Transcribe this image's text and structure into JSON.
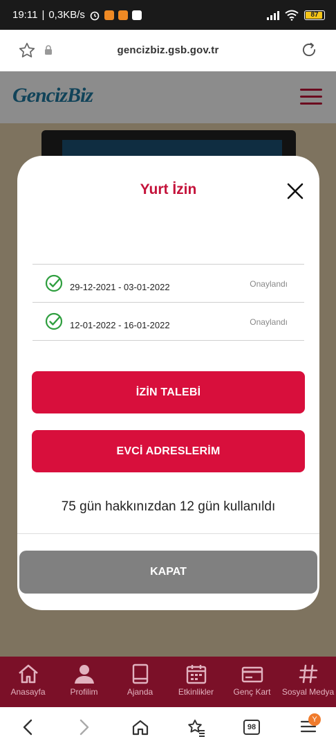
{
  "status_bar": {
    "time": "19:11",
    "speed": "0,3KB/s",
    "battery": "87"
  },
  "browser": {
    "url": "gencizbiz.gsb.gov.tr",
    "tab_count": "98",
    "menu_badge": "Y"
  },
  "site": {
    "logo": "GencizBiz",
    "brand_color": "#c4123a"
  },
  "modal": {
    "title": "Yurt İzin",
    "permits": [
      {
        "dates": "29-12-2021 - 03-01-2022",
        "status": "Onaylandı"
      },
      {
        "dates": "12-01-2022 - 16-01-2022",
        "status": "Onaylandı"
      }
    ],
    "request_button": "İZİN TALEBİ",
    "address_button": "EVCİ ADRESLERİM",
    "usage_text": "75 gün hakkınızdan 12 gün kullanıldı",
    "close_button": "KAPAT"
  },
  "site_nav": {
    "items": [
      {
        "label": "Anasayfa",
        "icon": "home-icon"
      },
      {
        "label": "Profilim",
        "icon": "person-icon"
      },
      {
        "label": "Ajanda",
        "icon": "book-icon"
      },
      {
        "label": "Etkinlikler",
        "icon": "calendar-icon"
      },
      {
        "label": "Genç Kart",
        "icon": "card-icon"
      },
      {
        "label": "Sosyal Medya",
        "icon": "hashtag-icon"
      }
    ]
  }
}
